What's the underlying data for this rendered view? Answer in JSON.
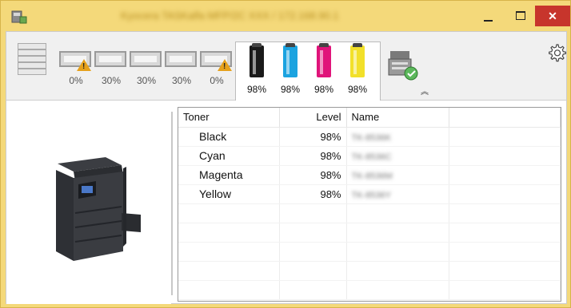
{
  "window": {
    "title": "Kyocera TASKalfa MFP/2C XXX / 172.168.90.1",
    "controls": {
      "minimize": "–",
      "maximize": "□",
      "close": "✕"
    }
  },
  "toolbar": {
    "paper_trays": [
      {
        "label": "0%",
        "warning": true
      },
      {
        "label": "30%",
        "warning": false
      },
      {
        "label": "30%",
        "warning": false
      },
      {
        "label": "30%",
        "warning": false
      },
      {
        "label": "0%",
        "warning": true
      }
    ],
    "toners": [
      {
        "label": "98%",
        "color": "#1a1a1a"
      },
      {
        "label": "98%",
        "color": "#1ba3e0"
      },
      {
        "label": "98%",
        "color": "#e0147a"
      },
      {
        "label": "98%",
        "color": "#f2e02a"
      }
    ],
    "collapse_glyph": "︽"
  },
  "table": {
    "headers": {
      "toner": "Toner",
      "level": "Level",
      "name": "Name"
    },
    "rows": [
      {
        "toner": "Black",
        "level": "98%",
        "name": "TK-8536K"
      },
      {
        "toner": "Cyan",
        "level": "98%",
        "name": "TK-8536C"
      },
      {
        "toner": "Magenta",
        "level": "98%",
        "name": "TK-8536M"
      },
      {
        "toner": "Yellow",
        "level": "98%",
        "name": "TK-8536Y"
      }
    ]
  }
}
